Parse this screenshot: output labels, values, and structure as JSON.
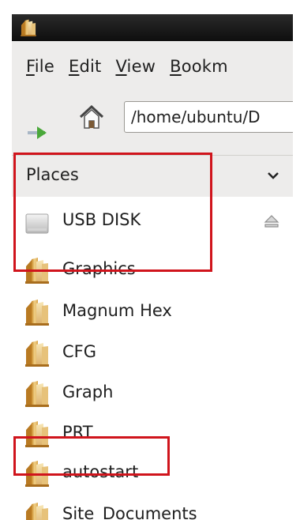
{
  "menubar": {
    "items": [
      {
        "mnemonic": "F",
        "rest": "ile"
      },
      {
        "mnemonic": "E",
        "rest": "dit"
      },
      {
        "mnemonic": "V",
        "rest": "iew"
      },
      {
        "mnemonic": "B",
        "rest": "ookm"
      }
    ]
  },
  "toolbar": {
    "location": "/home/ubuntu/D"
  },
  "sidebar": {
    "header": "Places",
    "items": [
      {
        "label": "USB DISK",
        "icon": "drive-icon"
      },
      {
        "label": "Graphics",
        "icon": "folder-icon"
      },
      {
        "label": "Magnum Hex",
        "icon": "folder-icon"
      },
      {
        "label": "CFG",
        "icon": "folder-icon"
      },
      {
        "label": "Graph",
        "icon": "folder-icon"
      },
      {
        "label": "PRT",
        "icon": "folder-icon"
      },
      {
        "label": "autostart",
        "icon": "folder-icon"
      },
      {
        "label": "Site_Documents",
        "icon": "folder-icon"
      }
    ]
  },
  "colors": {
    "highlight": "#d0141c",
    "panel": "#edeceb",
    "titlebar": "#0e0e0e"
  }
}
